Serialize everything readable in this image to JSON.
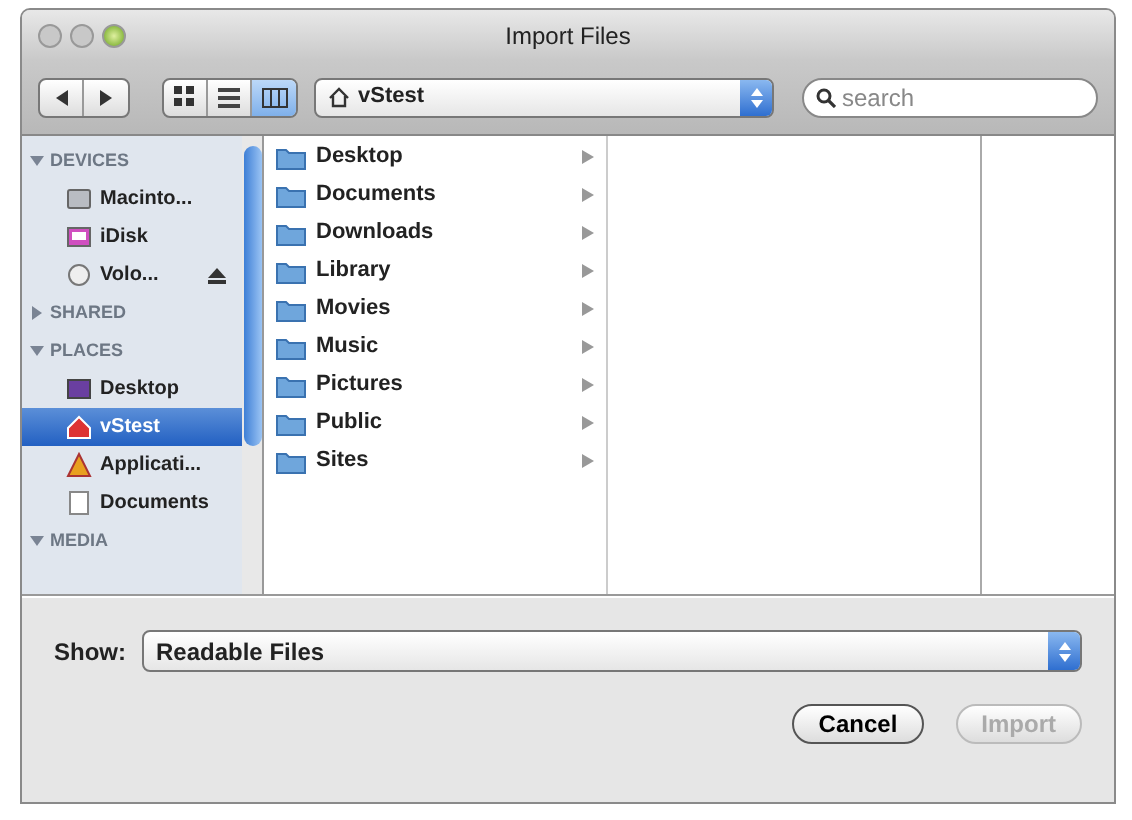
{
  "window": {
    "title": "Import Files"
  },
  "toolbar": {
    "view_modes": [
      {
        "kind": "icon",
        "selected": false
      },
      {
        "kind": "list",
        "selected": false
      },
      {
        "kind": "column",
        "selected": true
      }
    ],
    "location": "vStest",
    "search": {
      "placeholder": "search"
    }
  },
  "sidebar": {
    "sections": [
      {
        "title": "DEVICES",
        "expanded": true,
        "items": [
          {
            "label": "Macinto...",
            "kind": "disk",
            "selected": false
          },
          {
            "label": "iDisk",
            "kind": "idisk",
            "selected": false
          },
          {
            "label": "Volo...",
            "kind": "volume",
            "selected": false,
            "ejectable": true
          }
        ]
      },
      {
        "title": "SHARED",
        "expanded": false
      },
      {
        "title": "PLACES",
        "expanded": true,
        "items": [
          {
            "label": "Desktop",
            "kind": "desktop",
            "selected": false
          },
          {
            "label": "vStest",
            "kind": "home",
            "selected": true
          },
          {
            "label": "Applicati...",
            "kind": "apps",
            "selected": false
          },
          {
            "label": "Documents",
            "kind": "document",
            "selected": false
          }
        ]
      },
      {
        "title": "MEDIA",
        "expanded": true
      }
    ]
  },
  "columns": [
    {
      "items": [
        {
          "name": "Desktop"
        },
        {
          "name": "Documents"
        },
        {
          "name": "Downloads"
        },
        {
          "name": "Library"
        },
        {
          "name": "Movies"
        },
        {
          "name": "Music"
        },
        {
          "name": "Pictures"
        },
        {
          "name": "Public"
        },
        {
          "name": "Sites"
        }
      ]
    }
  ],
  "show": {
    "label": "Show:",
    "value": "Readable Files"
  },
  "buttons": [
    {
      "label": "Cancel",
      "disabled": false
    },
    {
      "label": "Import",
      "disabled": true
    }
  ]
}
